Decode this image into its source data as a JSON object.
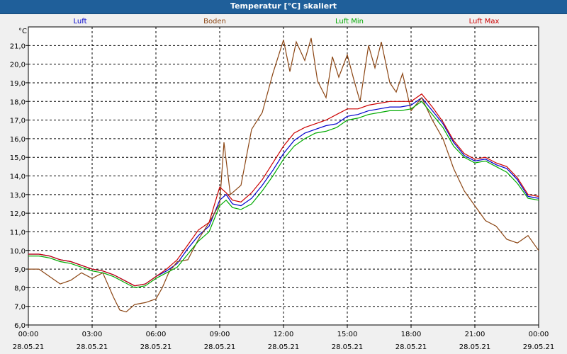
{
  "chart_data": {
    "type": "line",
    "title": "Temperatur [°C] skaliert",
    "ylabel": "°C",
    "ylim": [
      6.0,
      22.0
    ],
    "yticks": [
      "6,0",
      "7,0",
      "8,0",
      "9,0",
      "10,0",
      "11,0",
      "12,0",
      "13,0",
      "14,0",
      "15,0",
      "16,0",
      "17,0",
      "18,0",
      "19,0",
      "20,0",
      "21,0"
    ],
    "xlim_hours": [
      0,
      24
    ],
    "xticks": [
      {
        "time": "00:00",
        "date": "28.05.21",
        "h": 0
      },
      {
        "time": "03:00",
        "date": "28.05.21",
        "h": 3
      },
      {
        "time": "06:00",
        "date": "28.05.21",
        "h": 6
      },
      {
        "time": "09:00",
        "date": "28.05.21",
        "h": 9
      },
      {
        "time": "12:00",
        "date": "28.05.21",
        "h": 12
      },
      {
        "time": "15:00",
        "date": "28.05.21",
        "h": 15
      },
      {
        "time": "18:00",
        "date": "28.05.21",
        "h": 18
      },
      {
        "time": "21:00",
        "date": "28.05.21",
        "h": 21
      },
      {
        "time": "00:00",
        "date": "29.05.21",
        "h": 24
      }
    ],
    "grid": true,
    "legend_position": "top",
    "series": [
      {
        "name": "Luft",
        "color": "#0000cc",
        "points": [
          [
            0,
            9.8
          ],
          [
            0.5,
            9.8
          ],
          [
            1,
            9.7
          ],
          [
            1.5,
            9.5
          ],
          [
            2,
            9.4
          ],
          [
            2.5,
            9.2
          ],
          [
            3,
            9.0
          ],
          [
            3.5,
            8.9
          ],
          [
            4,
            8.7
          ],
          [
            4.5,
            8.4
          ],
          [
            5,
            8.1
          ],
          [
            5.5,
            8.2
          ],
          [
            6,
            8.6
          ],
          [
            6.5,
            8.9
          ],
          [
            7,
            9.3
          ],
          [
            7.5,
            10.1
          ],
          [
            8,
            10.8
          ],
          [
            8.5,
            11.3
          ],
          [
            9,
            12.7
          ],
          [
            9.3,
            13.0
          ],
          [
            9.6,
            12.5
          ],
          [
            10,
            12.4
          ],
          [
            10.5,
            12.8
          ],
          [
            11,
            13.5
          ],
          [
            11.5,
            14.3
          ],
          [
            12,
            15.2
          ],
          [
            12.5,
            15.9
          ],
          [
            13,
            16.3
          ],
          [
            13.5,
            16.5
          ],
          [
            14,
            16.7
          ],
          [
            14.5,
            16.8
          ],
          [
            15,
            17.2
          ],
          [
            15.5,
            17.3
          ],
          [
            16,
            17.5
          ],
          [
            16.5,
            17.6
          ],
          [
            17,
            17.7
          ],
          [
            17.5,
            17.7
          ],
          [
            18,
            17.8
          ],
          [
            18.5,
            18.2
          ],
          [
            19,
            17.5
          ],
          [
            19.5,
            16.8
          ],
          [
            20,
            15.8
          ],
          [
            20.5,
            15.1
          ],
          [
            21,
            14.8
          ],
          [
            21.5,
            14.9
          ],
          [
            22,
            14.6
          ],
          [
            22.5,
            14.4
          ],
          [
            23,
            13.8
          ],
          [
            23.5,
            12.9
          ],
          [
            24,
            12.8
          ]
        ]
      },
      {
        "name": "Boden",
        "color": "#8b4513",
        "points": [
          [
            0,
            9.0
          ],
          [
            0.5,
            9.0
          ],
          [
            1,
            8.6
          ],
          [
            1.5,
            8.2
          ],
          [
            2,
            8.4
          ],
          [
            2.5,
            8.8
          ],
          [
            3,
            8.5
          ],
          [
            3.5,
            8.8
          ],
          [
            4,
            7.5
          ],
          [
            4.3,
            6.8
          ],
          [
            4.6,
            6.7
          ],
          [
            5,
            7.1
          ],
          [
            5.5,
            7.2
          ],
          [
            6,
            7.4
          ],
          [
            6.3,
            8.0
          ],
          [
            6.6,
            8.8
          ],
          [
            7,
            9.4
          ],
          [
            7.5,
            9.5
          ],
          [
            8,
            10.6
          ],
          [
            8.5,
            11.5
          ],
          [
            9,
            12.5
          ],
          [
            9.2,
            15.8
          ],
          [
            9.5,
            13.0
          ],
          [
            10,
            13.5
          ],
          [
            10.5,
            16.5
          ],
          [
            11,
            17.4
          ],
          [
            11.5,
            19.5
          ],
          [
            12,
            21.3
          ],
          [
            12.3,
            19.6
          ],
          [
            12.6,
            21.2
          ],
          [
            13,
            20.2
          ],
          [
            13.3,
            21.4
          ],
          [
            13.6,
            19.1
          ],
          [
            14,
            18.2
          ],
          [
            14.3,
            20.4
          ],
          [
            14.6,
            19.3
          ],
          [
            15,
            20.5
          ],
          [
            15.3,
            19.2
          ],
          [
            15.6,
            18.0
          ],
          [
            16,
            21.0
          ],
          [
            16.3,
            19.8
          ],
          [
            16.6,
            21.2
          ],
          [
            17,
            19.0
          ],
          [
            17.3,
            18.5
          ],
          [
            17.6,
            19.5
          ],
          [
            18,
            17.5
          ],
          [
            18.5,
            18.2
          ],
          [
            19,
            17.0
          ],
          [
            19.5,
            16.0
          ],
          [
            20,
            14.4
          ],
          [
            20.5,
            13.2
          ],
          [
            21,
            12.4
          ],
          [
            21.5,
            11.6
          ],
          [
            22,
            11.3
          ],
          [
            22.5,
            10.6
          ],
          [
            23,
            10.4
          ],
          [
            23.5,
            10.8
          ],
          [
            24,
            10.0
          ]
        ]
      },
      {
        "name": "Luft Min",
        "color": "#00aa00",
        "points": [
          [
            0,
            9.7
          ],
          [
            0.5,
            9.7
          ],
          [
            1,
            9.6
          ],
          [
            1.5,
            9.4
          ],
          [
            2,
            9.3
          ],
          [
            2.5,
            9.1
          ],
          [
            3,
            8.9
          ],
          [
            3.5,
            8.8
          ],
          [
            4,
            8.6
          ],
          [
            4.5,
            8.3
          ],
          [
            5,
            8.0
          ],
          [
            5.5,
            8.1
          ],
          [
            6,
            8.5
          ],
          [
            6.5,
            8.8
          ],
          [
            7,
            9.1
          ],
          [
            7.5,
            9.8
          ],
          [
            8,
            10.5
          ],
          [
            8.5,
            11.0
          ],
          [
            9,
            12.4
          ],
          [
            9.3,
            12.7
          ],
          [
            9.6,
            12.3
          ],
          [
            10,
            12.2
          ],
          [
            10.5,
            12.5
          ],
          [
            11,
            13.2
          ],
          [
            11.5,
            14.0
          ],
          [
            12,
            14.9
          ],
          [
            12.5,
            15.6
          ],
          [
            13,
            16.0
          ],
          [
            13.5,
            16.3
          ],
          [
            14,
            16.4
          ],
          [
            14.5,
            16.6
          ],
          [
            15,
            17.0
          ],
          [
            15.5,
            17.1
          ],
          [
            16,
            17.3
          ],
          [
            16.5,
            17.4
          ],
          [
            17,
            17.5
          ],
          [
            17.5,
            17.5
          ],
          [
            18,
            17.6
          ],
          [
            18.5,
            18.0
          ],
          [
            19,
            17.3
          ],
          [
            19.5,
            16.6
          ],
          [
            20,
            15.6
          ],
          [
            20.5,
            15.0
          ],
          [
            21,
            14.7
          ],
          [
            21.5,
            14.8
          ],
          [
            22,
            14.5
          ],
          [
            22.5,
            14.2
          ],
          [
            23,
            13.6
          ],
          [
            23.5,
            12.8
          ],
          [
            24,
            12.7
          ]
        ]
      },
      {
        "name": "Luft Max",
        "color": "#cc0000",
        "points": [
          [
            0,
            9.8
          ],
          [
            0.5,
            9.8
          ],
          [
            1,
            9.7
          ],
          [
            1.5,
            9.5
          ],
          [
            2,
            9.4
          ],
          [
            2.5,
            9.2
          ],
          [
            3,
            9.0
          ],
          [
            3.5,
            8.9
          ],
          [
            4,
            8.7
          ],
          [
            4.5,
            8.4
          ],
          [
            5,
            8.1
          ],
          [
            5.5,
            8.2
          ],
          [
            6,
            8.6
          ],
          [
            6.5,
            9.0
          ],
          [
            7,
            9.5
          ],
          [
            7.5,
            10.3
          ],
          [
            8,
            11.1
          ],
          [
            8.5,
            11.5
          ],
          [
            9,
            13.4
          ],
          [
            9.3,
            13.1
          ],
          [
            9.6,
            12.7
          ],
          [
            10,
            12.6
          ],
          [
            10.5,
            13.1
          ],
          [
            11,
            13.8
          ],
          [
            11.5,
            14.7
          ],
          [
            12,
            15.6
          ],
          [
            12.5,
            16.3
          ],
          [
            13,
            16.6
          ],
          [
            13.5,
            16.8
          ],
          [
            14,
            17.0
          ],
          [
            14.5,
            17.3
          ],
          [
            15,
            17.6
          ],
          [
            15.5,
            17.6
          ],
          [
            16,
            17.8
          ],
          [
            16.5,
            17.9
          ],
          [
            17,
            18.0
          ],
          [
            17.5,
            18.0
          ],
          [
            18,
            18.0
          ],
          [
            18.5,
            18.4
          ],
          [
            19,
            17.7
          ],
          [
            19.5,
            16.9
          ],
          [
            20,
            15.9
          ],
          [
            20.5,
            15.2
          ],
          [
            21,
            14.9
          ],
          [
            21.5,
            15.0
          ],
          [
            22,
            14.7
          ],
          [
            22.5,
            14.5
          ],
          [
            23,
            13.9
          ],
          [
            23.5,
            13.0
          ],
          [
            24,
            12.9
          ]
        ]
      }
    ]
  }
}
